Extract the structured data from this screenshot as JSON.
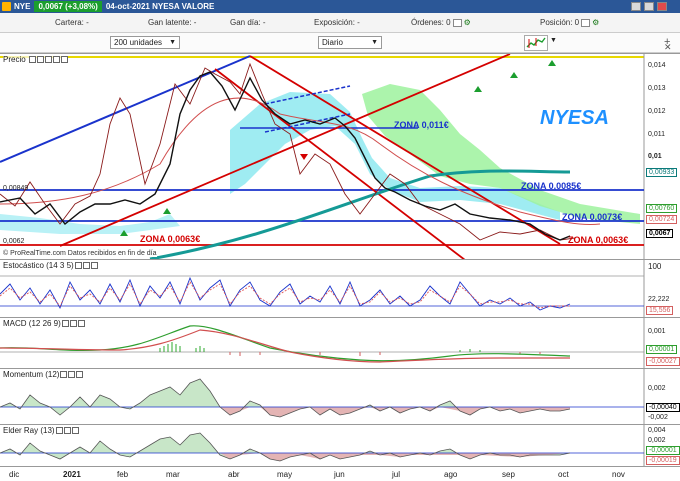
{
  "titlebar": {
    "ticker": "NYE",
    "price_change": "0,0067 (+3,08%)",
    "description": "04-oct-2021 NYESA VALORE"
  },
  "posbar": {
    "cartera": "Cartera: -",
    "gan_latente": "Gan latente: -",
    "gan_dia": "Gan día: -",
    "exposicion": "Exposición: -",
    "ordenes": "Órdenes: 0",
    "posicion": "Posición: 0"
  },
  "toolbar": {
    "units": "200 unidades",
    "period": "Diario"
  },
  "price_panel": {
    "title": "Precio",
    "watermark": "NYESA",
    "credit": "© ProRealTime.com  Datos recibidos en fin de día",
    "zones": [
      {
        "label": "ZONA 0,011€",
        "color": "#1a33cc"
      },
      {
        "label": "ZONA 0,0085€",
        "color": "#1a33cc"
      },
      {
        "label": "ZONA 0,0073€",
        "color": "#1a33cc"
      },
      {
        "label": "ZONA 0,0063€",
        "color": "#d40000"
      },
      {
        "label": "ZONA 0,0063€",
        "color": "#d40000"
      }
    ],
    "y_ticks": [
      "0,014",
      "0,013",
      "0,012",
      "0,011",
      "0,01"
    ],
    "left_labels": [
      "0,00849",
      "0,0062"
    ],
    "badges": [
      {
        "text": "0,00933",
        "color": "#0a7a7a"
      },
      {
        "text": "0,00760",
        "color": "#2e9e2e"
      },
      {
        "text": "0,00724",
        "color": "#d46060"
      },
      {
        "text": "0,0067",
        "color": "#000000"
      }
    ]
  },
  "stochastic": {
    "title": "Estocástico (14 3 5)",
    "y_labels": [
      "100",
      "22,222",
      "15,556"
    ]
  },
  "macd": {
    "title": "MACD (12 26 9)",
    "y_labels": [
      "0,001",
      "0,00001",
      "-0,00027"
    ]
  },
  "momentum": {
    "title": "Momentum (12)",
    "y_labels": [
      "0,002",
      "-0,00040",
      "-0,002"
    ]
  },
  "elder": {
    "title": "Elder Ray (13)",
    "y_labels": [
      "0,004",
      "0,002",
      "-0,00001",
      "-0,00019"
    ]
  },
  "xaxis": {
    "labels": [
      "dic",
      "2021",
      "feb",
      "mar",
      "abr",
      "may",
      "jun",
      "jul",
      "ago",
      "sep",
      "oct",
      "nov"
    ]
  }
}
